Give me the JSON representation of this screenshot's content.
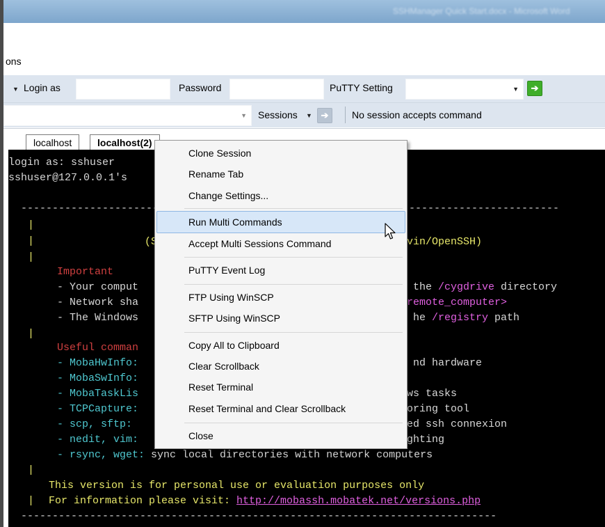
{
  "window": {
    "title": "SSHManager Quick Start.docx - Microsoft Word"
  },
  "menu": {
    "partial_label": "ons"
  },
  "toolbar": {
    "login_as_label": "Login as",
    "password_label": "Password",
    "putty_setting_label": "PuTTY Setting",
    "sessions_label": "Sessions",
    "status_text": "No session accepts command"
  },
  "tabs": [
    {
      "label": "localhost"
    },
    {
      "label": "localhost(2)"
    }
  ],
  "terminal": {
    "line1": "login as: sshuser",
    "line2": "sshuser@127.0.0.1's",
    "dash_left": "  ------------------------------------------------",
    "dash_right": "------------------------",
    "s_prefix": "(S",
    "s_suffix": "vin/OpenSSH)",
    "important": "Important",
    "imp1a": "- Your comput",
    "imp1b": " the ",
    "imp1c": "/cygdrive",
    "imp1d": " directory",
    "imp2a": "- Network sha",
    "imp2b": "remote_computer>",
    "imp3a": "- The Windows",
    "imp3b": "he ",
    "imp3c": "/registry",
    "imp3d": " path",
    "useful": "Useful comman",
    "u1a": "- MobaHwInfo:",
    "u1b": "nd hardware",
    "u2a": "- MobaSwInfo:",
    "u3a": "- MobaTaskLis",
    "u3b": "ws tasks",
    "u4a": "- TCPCapture:",
    "u4b": "oring tool",
    "u5a": "- scp, sftp:",
    "u5b": "ed ssh connexion",
    "u6a": "- nedit, vim:",
    "u6b": "ghting",
    "u7a": "- rsync, wget:",
    "u7b": " sync local directories with network computers",
    "personal": "This version is for personal use or evaluation purposes only",
    "info_prefix": "For information please visit: ",
    "info_url": "http://mobassh.mobatek.net/versions.php",
    "dash_bottom": "  ----------------------------------------------------------------------------"
  },
  "context_menu": {
    "items": [
      {
        "label": "Clone Session"
      },
      {
        "label": "Rename Tab"
      },
      {
        "label": "Change Settings..."
      },
      {
        "label": "Run Multi Commands"
      },
      {
        "label": "Accept Multi Sessions Command"
      },
      {
        "label": "PuTTY Event Log"
      },
      {
        "label": "FTP Using WinSCP"
      },
      {
        "label": "SFTP Using WinSCP"
      },
      {
        "label": "Copy All to Clipboard"
      },
      {
        "label": "Clear Scrollback"
      },
      {
        "label": "Reset Terminal"
      },
      {
        "label": "Reset Terminal and Clear Scrollback"
      },
      {
        "label": "Close"
      }
    ]
  },
  "colors": {
    "go_button_active": "#3fae2a",
    "go_button_disabled": "#b8c4d2",
    "menu_highlight": "#d7e7f8"
  }
}
